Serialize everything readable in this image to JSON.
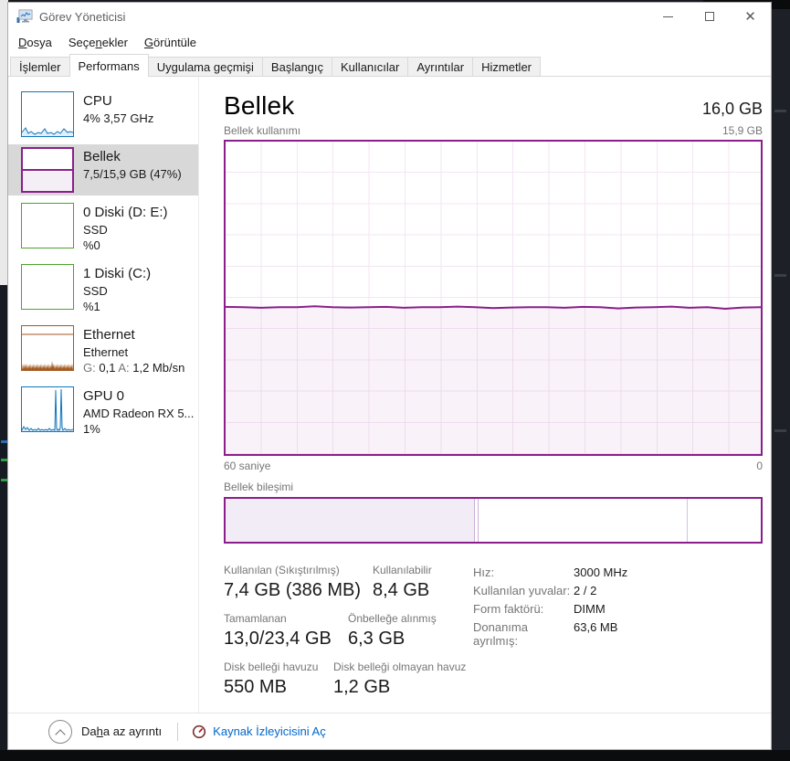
{
  "window": {
    "title": "Görev Yöneticisi"
  },
  "menu": {
    "items": [
      {
        "pre": "",
        "key": "D",
        "post": "osya"
      },
      {
        "pre": "Seçe",
        "key": "n",
        "post": "ekler"
      },
      {
        "pre": "",
        "key": "G",
        "post": "örüntüle"
      }
    ]
  },
  "tabs": {
    "active": "Performans",
    "items": [
      {
        "label": "İşlemler"
      },
      {
        "label": "Performans"
      },
      {
        "label": "Uygulama geçmişi"
      },
      {
        "label": "Başlangıç"
      },
      {
        "label": "Kullanıcılar"
      },
      {
        "label": "Ayrıntılar"
      },
      {
        "label": "Hizmetler"
      }
    ]
  },
  "sidebar": {
    "items": [
      {
        "title": "CPU",
        "line2": "4% 3,57 GHz"
      },
      {
        "title": "Bellek",
        "line2": "7,5/15,9 GB (47%)",
        "selected": true
      },
      {
        "title": "0 Diski (D: E:)",
        "line2": "SSD",
        "line3": "%0"
      },
      {
        "title": "1 Diski (C:)",
        "line2": "SSD",
        "line3": "%1"
      },
      {
        "title": "Ethernet",
        "line2": "Ethernet",
        "g_label": "G:",
        "g_value": " 0,1 ",
        "a_label": "A:",
        "a_value": " 1,2 Mb/sn"
      },
      {
        "title": "GPU 0",
        "line2": "AMD Radeon RX 5...",
        "line3": "1%"
      }
    ]
  },
  "main": {
    "title": "Bellek",
    "capacity": "16,0 GB",
    "usage_label": "Bellek kullanımı",
    "scale_max": "15,9 GB",
    "x_left": "60 saniye",
    "x_right": "0",
    "composition_label": "Bellek bileşimi",
    "stats": {
      "rows": [
        [
          {
            "label": "Kullanılan (Sıkıştırılmış)",
            "value": "7,4 GB (386 MB)"
          },
          {
            "label": "Kullanılabilir",
            "value": "8,4 GB"
          }
        ],
        [
          {
            "label": "Tamamlanan",
            "value": "13,0/23,4 GB"
          },
          {
            "label": "Önbelleğe alınmış",
            "value": "6,3 GB"
          }
        ],
        [
          {
            "label": "Disk belleği havuzu",
            "value": "550 MB"
          },
          {
            "label": "Disk belleği olmayan havuz",
            "value": "1,2 GB"
          }
        ]
      ]
    },
    "details": [
      {
        "label": "Hız:",
        "value": "3000 MHz"
      },
      {
        "label": "Kullanılan yuvalar:",
        "value": "2 / 2"
      },
      {
        "label": "Form faktörü:",
        "value": "DIMM"
      },
      {
        "label": "Donanıma ayrılmış:",
        "value": "63,6 MB"
      }
    ]
  },
  "footer": {
    "less_details": {
      "pre": "Da",
      "key": "h",
      "post": "a az ayrıntı"
    },
    "resource_monitor": "Kaynak İzleyicisini Aç"
  },
  "chart_data": {
    "type": "area",
    "title": "Bellek kullanımı",
    "x_label_left": "60 saniye",
    "x_label_right": "0",
    "y_max_label": "15,9 GB",
    "used_percent": 47,
    "series": [
      {
        "name": "memory-usage-percent",
        "values": [
          47.1,
          47.0,
          46.8,
          47.0,
          47.0,
          47.3,
          47.0,
          46.9,
          47.0,
          47.1,
          46.8,
          47.0,
          47.0,
          47.2,
          47.0,
          46.7,
          46.9,
          47.0,
          47.0,
          46.8,
          47.1,
          47.0,
          46.6,
          46.9,
          47.0,
          47.2,
          46.8,
          47.0,
          46.5,
          46.9,
          47.0
        ]
      }
    ],
    "composition": {
      "segments_percent": [
        46.6,
        0.7,
        39.0,
        13.7
      ]
    }
  },
  "colors": {
    "memory_accent": "#8b1e8b",
    "cpu_accent": "#1176bb",
    "disk_accent": "#4ca32c",
    "ethernet_accent": "#a35a21",
    "gpu_accent": "#1176bb",
    "link": "#0066cc",
    "selected_tile_bg": "#d8d8d8"
  }
}
